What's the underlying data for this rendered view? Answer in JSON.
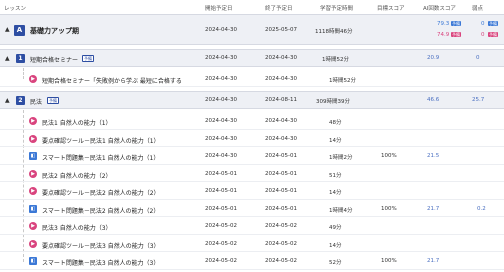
{
  "header": {
    "lesson": "レッスン",
    "start": "開始予定日",
    "end": "終了予定日",
    "study_time": "学習予定時間",
    "target": "目標スコア",
    "ai": "AI回数スコア",
    "weak": "弱点"
  },
  "course": {
    "badge": "A",
    "title": "基礎力アップ期",
    "start": "2024-04-30",
    "end": "2025-05-07",
    "time": "1118時間46分",
    "ai_top": "79.3",
    "ai_top_tag": "予備",
    "ai_bottom": "74.9",
    "ai_bottom_tag": "予備",
    "weak_top": "0",
    "weak_top_tag": "予備",
    "weak_bottom": "0",
    "weak_bottom_tag": "予備"
  },
  "unit1": {
    "badge": "1",
    "title": "短期合格セミナー",
    "tag": "予備",
    "start": "2024-04-30",
    "end": "2024-04-30",
    "time": "1時間52分",
    "ai": "20.9",
    "weak": "0"
  },
  "unit1_items": [
    {
      "title": "短期合格セミナー「失敗例から学ぶ 最短に合格する",
      "start": "2024-04-30",
      "end": "2024-04-30",
      "time": "1時間52分",
      "target": "",
      "ai": "",
      "weak": ""
    }
  ],
  "unit2": {
    "badge": "2",
    "title": "民法",
    "tag": "予備",
    "start": "2024-04-30",
    "end": "2024-08-11",
    "time": "309時間39分",
    "ai": "46.6",
    "weak": "25.7"
  },
  "unit2_items": [
    {
      "icon": "pink",
      "title": "民法1 自然人の能力（1）",
      "start": "2024-04-30",
      "end": "2024-04-30",
      "time": "48分",
      "target": "",
      "ai": "",
      "weak": ""
    },
    {
      "icon": "pink",
      "title": "要点確認ツール－民法1 自然人の能力（1）",
      "start": "2024-04-30",
      "end": "2024-04-30",
      "time": "14分",
      "target": "",
      "ai": "",
      "weak": ""
    },
    {
      "icon": "blue",
      "title": "スマート問題集－民法1 自然人の能力（1）",
      "start": "2024-04-30",
      "end": "2024-05-01",
      "time": "1時間2分",
      "target": "100%",
      "ai": "21.5",
      "weak": ""
    },
    {
      "icon": "pink",
      "title": "民法2 自然人の能力（2）",
      "start": "2024-05-01",
      "end": "2024-05-01",
      "time": "51分",
      "target": "",
      "ai": "",
      "weak": ""
    },
    {
      "icon": "pink",
      "title": "要点確認ツール－民法2 自然人の能力（2）",
      "start": "2024-05-01",
      "end": "2024-05-01",
      "time": "14分",
      "target": "",
      "ai": "",
      "weak": ""
    },
    {
      "icon": "blue",
      "title": "スマート問題集－民法2 自然人の能力（2）",
      "start": "2024-05-01",
      "end": "2024-05-01",
      "time": "1時間4分",
      "target": "100%",
      "ai": "21.7",
      "weak": "0.2"
    },
    {
      "icon": "pink",
      "title": "民法3 自然人の能力（3）",
      "start": "2024-05-02",
      "end": "2024-05-02",
      "time": "49分",
      "target": "",
      "ai": "",
      "weak": ""
    },
    {
      "icon": "pink",
      "title": "要点確認ツール－民法3 自然人の能力（3）",
      "start": "2024-05-02",
      "end": "2024-05-02",
      "time": "14分",
      "target": "",
      "ai": "",
      "weak": ""
    },
    {
      "icon": "blue",
      "title": "スマート問題集－民法3 自然人の能力（3）",
      "start": "2024-05-02",
      "end": "2024-05-02",
      "time": "52分",
      "target": "100%",
      "ai": "21.7",
      "weak": ""
    }
  ],
  "colors": {
    "primary": "#2e4ea3",
    "pink": "#d9447e",
    "blue": "#3b78d6"
  },
  "icons": {
    "video": "play-circle-icon",
    "drill": "drill-icon",
    "collapse": "chevron-up-icon"
  }
}
